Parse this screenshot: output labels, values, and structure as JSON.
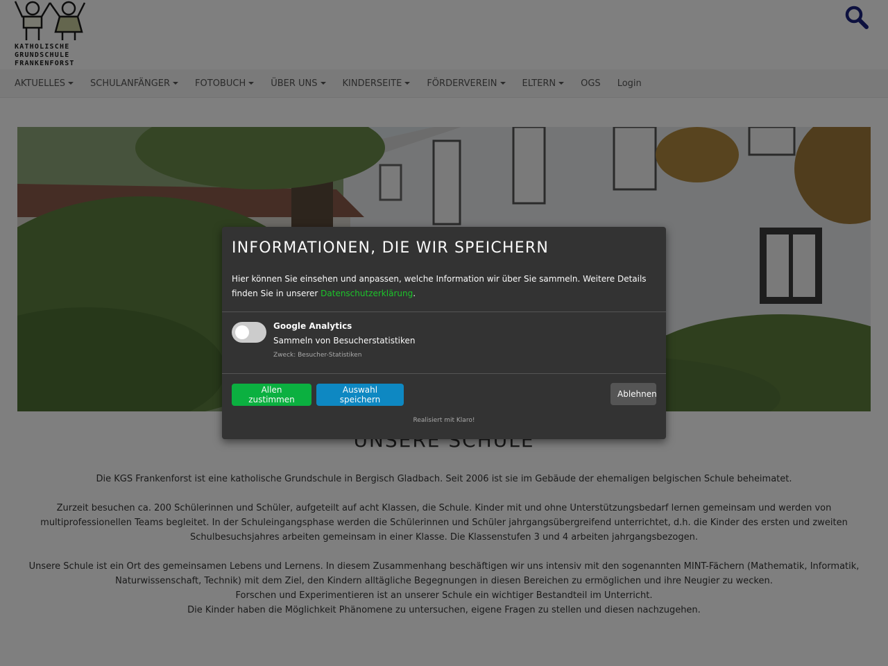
{
  "header": {
    "logo_lines": [
      "KATHOLISCHE",
      "GRUNDSCHULE",
      "FRANKENFORST"
    ],
    "search_icon": "search-icon"
  },
  "nav": {
    "items": [
      {
        "label": "AKTUELLES",
        "dropdown": true
      },
      {
        "label": "SCHULANFÄNGER",
        "dropdown": true
      },
      {
        "label": "FOTOBUCH",
        "dropdown": true
      },
      {
        "label": "ÜBER UNS",
        "dropdown": true
      },
      {
        "label": "KINDERSEITE",
        "dropdown": true
      },
      {
        "label": "FÖRDERVEREIN",
        "dropdown": true
      },
      {
        "label": "ELTERN",
        "dropdown": true
      },
      {
        "label": "OGS",
        "dropdown": false
      },
      {
        "label": "Login",
        "dropdown": false
      }
    ]
  },
  "content": {
    "title": "UNSERE SCHULE",
    "p1": "Die KGS Frankenforst ist eine katholische Grundschule in Bergisch Gladbach. Seit 2006 ist sie im Gebäude der ehemaligen belgischen Schule beheimatet.",
    "p2": "Zurzeit besuchen ca. 200 Schülerinnen und Schüler, aufgeteilt auf acht Klassen, die Schule. Kinder mit und ohne Unterstützungsbedarf lernen gemeinsam und werden von multiprofessionellen Teams begleitet. In der Schuleingangsphase werden die Schülerinnen und Schüler jahrgangsübergreifend unterrichtet, d.h. die Kinder des ersten und zweiten Schulbesuchsjahres arbeiten gemeinsam in einer Klasse. Die Klassenstufen 3 und 4 arbeiten jahrgangsbezogen.",
    "p3_line1": "Unsere Schule ist ein Ort des gemeinsamen Lebens und Lernens. In diesem Zusammenhang beschäftigen wir uns intensiv mit den sogenannten MINT-Fächern (Mathematik, Informatik, Naturwissenschaft, Technik) mit dem Ziel, den Kindern alltägliche Begegnungen in diesen Bereichen zu ermöglichen und ihre Neugier zu wecken.",
    "p3_line2": "Forschen und Experimentieren ist an unserer Schule ein wichtiger Bestandteil im Unterricht.",
    "p3_line3": "Die Kinder haben die Möglichkeit Phänomene zu untersuchen, eigene Fragen zu stellen und diesen nachzugehen."
  },
  "modal": {
    "title": "INFORMATIONEN, DIE WIR SPEICHERN",
    "desc_prefix": "Hier können Sie einsehen und anpassen, welche Information wir über Sie sammeln. Weitere Details finden Sie in unserer ",
    "privacy_link": "Datenschutzerklärung",
    "desc_suffix": ".",
    "service": {
      "name": "Google Analytics",
      "description": "Sammeln von Besucherstatistiken",
      "purpose": "Zweck: Besucher-Statistiken",
      "enabled": false
    },
    "accept_all": "Allen zustimmen",
    "save": "Auswahl speichern",
    "decline": "Ablehnen",
    "powered_by": "Realisiert mit Klaro!"
  },
  "colors": {
    "modal_bg": "#333333",
    "accept": "#0bb040",
    "save": "#0e88c2",
    "decline": "#555555",
    "link": "#1cc52a",
    "search": "#1a237e"
  }
}
